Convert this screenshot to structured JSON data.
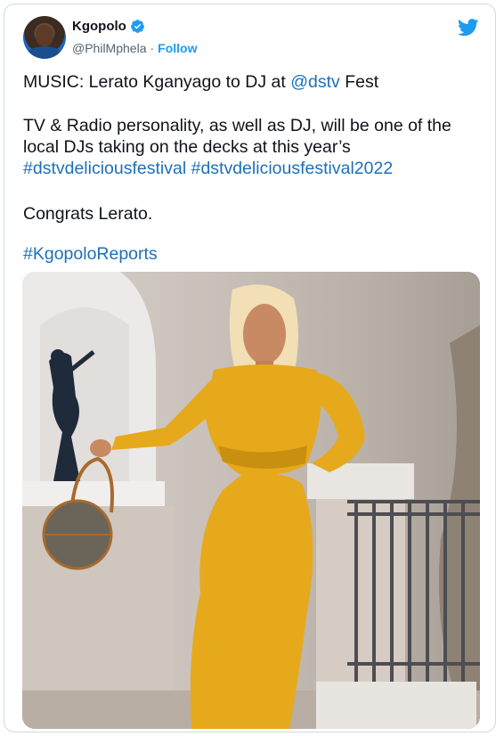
{
  "author": {
    "name": "Kgopolo",
    "handle": "@PhilMphela",
    "separator": "·",
    "follow_label": "Follow"
  },
  "tweet": {
    "line1_prefix": "MUSIC: Lerato Kganyago to DJ at ",
    "line1_mention": "@dstv",
    "line1_suffix": " Fest",
    "para2_line1": "TV & Radio personality, as well as DJ, will be one of the",
    "para2_line2": "local DJs taking on the decks at this year’s",
    "hashtag1": "#dstvdeliciousfestival",
    "hashtag2": "#dstvdeliciousfestival2022",
    "congrats": "Congrats Lerato.",
    "hashtag3": "#KgopoloReports"
  },
  "colors": {
    "link": "#1d70b8",
    "twitter_blue": "#1d9bf0",
    "dress": "#e6a91c"
  },
  "icons": [
    "verified-badge-icon",
    "twitter-bird-icon"
  ]
}
